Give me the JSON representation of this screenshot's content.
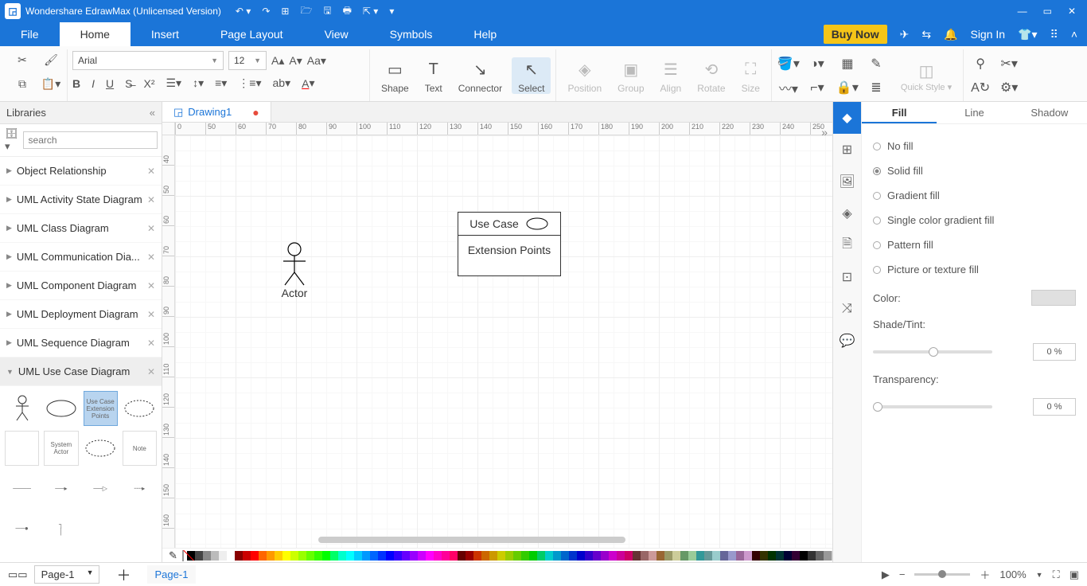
{
  "app": {
    "title": "Wondershare EdrawMax (Unlicensed Version)"
  },
  "menu": {
    "tabs": [
      "File",
      "Home",
      "Insert",
      "Page Layout",
      "View",
      "Symbols",
      "Help"
    ],
    "active": 1,
    "buy": "Buy Now",
    "signin": "Sign In"
  },
  "ribbon": {
    "font": "Arial",
    "size": "12",
    "shape": "Shape",
    "text": "Text",
    "connector": "Connector",
    "select": "Select",
    "position": "Position",
    "group": "Group",
    "align": "Align",
    "rotate": "Rotate",
    "sizeLbl": "Size",
    "quick": "Quick Style ▾"
  },
  "libraries": {
    "title": "Libraries",
    "search_ph": "search",
    "items": [
      {
        "label": "Object Relationship"
      },
      {
        "label": "UML Activity State Diagram"
      },
      {
        "label": "UML Class Diagram"
      },
      {
        "label": "UML Communication Dia..."
      },
      {
        "label": "UML Component Diagram"
      },
      {
        "label": "UML Deployment Diagram"
      },
      {
        "label": "UML Sequence Diagram"
      },
      {
        "label": "UML Use Case Diagram"
      }
    ],
    "active": 7,
    "shapes": [
      "Actor",
      "Use Case",
      "Use Case\nExtension Points",
      "Use Case\nCollaboration Points",
      "",
      "System Actor",
      "Collaboration X",
      "Note",
      "",
      "",
      "",
      "",
      "",
      ""
    ]
  },
  "doc": {
    "tab": "Drawing1"
  },
  "canvas": {
    "hruler": [
      "0",
      "50",
      "60",
      "70",
      "80",
      "90",
      "100",
      "110",
      "120",
      "130",
      "140",
      "150",
      "160",
      "170",
      "180",
      "190",
      "200",
      "210",
      "220",
      "230",
      "240",
      "250"
    ],
    "vruler": [
      "40",
      "50",
      "60",
      "70",
      "80",
      "90",
      "100",
      "110",
      "120",
      "130",
      "140",
      "150",
      "160"
    ],
    "actor": "Actor",
    "usecase": {
      "title": "Use Case",
      "ext": "Extension Points"
    }
  },
  "right": {
    "tabs": [
      "Fill",
      "Line",
      "Shadow"
    ],
    "active": 0,
    "opts": [
      "No fill",
      "Solid fill",
      "Gradient fill",
      "Single color gradient fill",
      "Pattern fill",
      "Picture or texture fill"
    ],
    "selected": 1,
    "colorLbl": "Color:",
    "shadeLbl": "Shade/Tint:",
    "transLbl": "Transparency:",
    "pct": "0 %"
  },
  "status": {
    "page": "Page-1",
    "tab": "Page-1",
    "zoom": "100%"
  }
}
